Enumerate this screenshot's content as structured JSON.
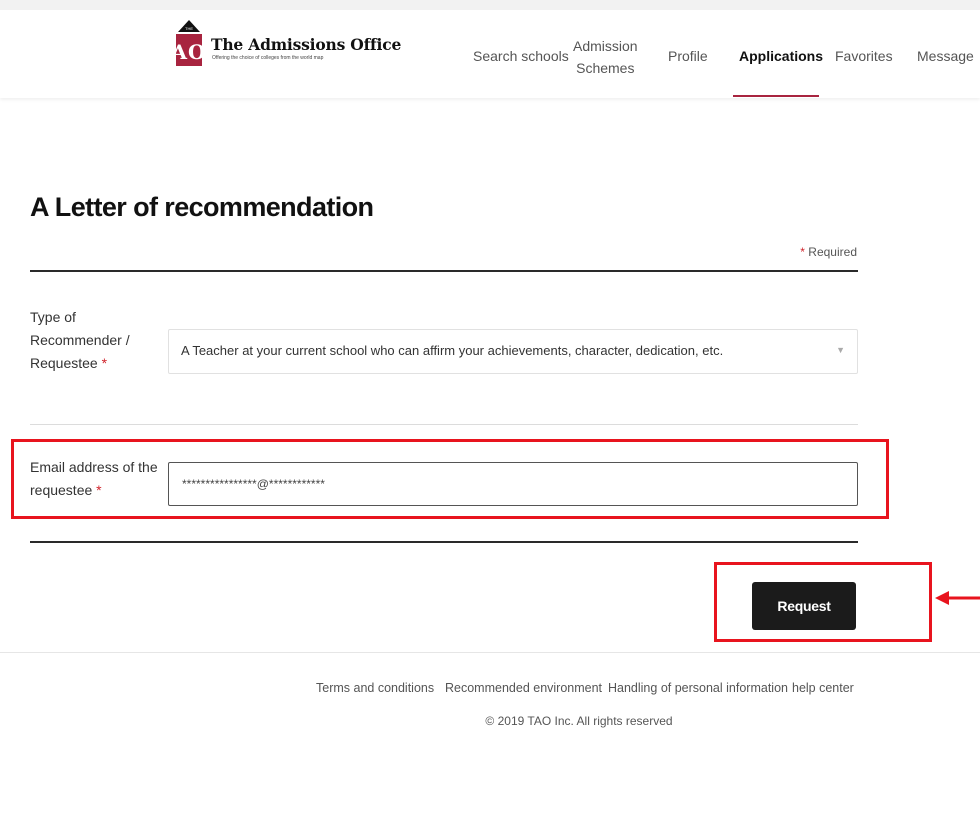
{
  "brand": {
    "logo_letters": "AO",
    "logo_small": "THE",
    "title": "The Admissions Office",
    "tagline": "Offering the choice of colleges from the world map"
  },
  "nav": {
    "items": [
      {
        "label": "Search schools"
      },
      {
        "label": "Admission\nSchemes"
      },
      {
        "label": "Profile"
      },
      {
        "label": "Applications",
        "active": true
      },
      {
        "label": "Favorites"
      },
      {
        "label": "Message"
      }
    ]
  },
  "form": {
    "title": "A Letter of recommendation",
    "required_star": "*",
    "required_note": "Required",
    "recommender": {
      "label_line1": "Type of",
      "label_line2": "Recommender /",
      "label_line3": "Requestee",
      "value": "A Teacher at your current school who can affirm your achievements, character, dedication, etc.",
      "caret_icon": "chevron-down-icon"
    },
    "email": {
      "label_line1": "Email address of the",
      "label_line2": "requestee",
      "value": "****************@************"
    },
    "request_button": "Request"
  },
  "footer": {
    "links": [
      {
        "label": "Terms and conditions"
      },
      {
        "label": "Recommended environment"
      },
      {
        "label": "Handling of personal information"
      },
      {
        "label": "help center"
      }
    ],
    "copyright": "© 2019 TAO Inc. All rights reserved"
  },
  "colors": {
    "accent": "#a8243f",
    "highlight": "#e8141e",
    "button_bg": "#1b1b1b",
    "required": "#d0232b"
  }
}
